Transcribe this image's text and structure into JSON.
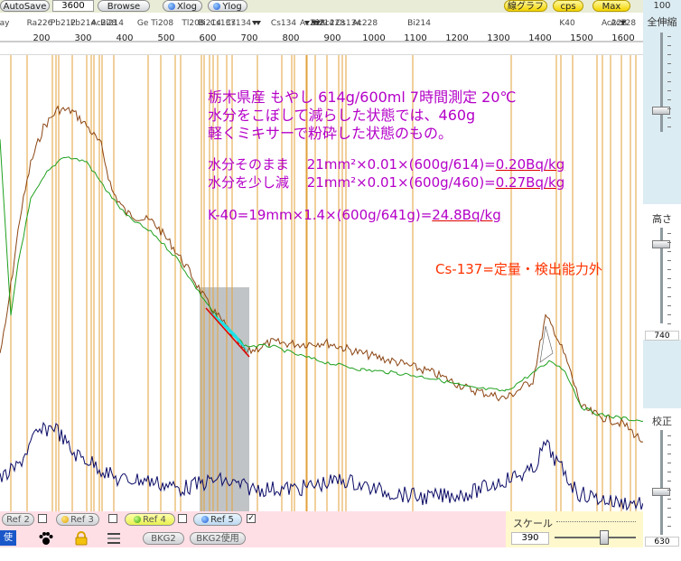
{
  "toolbar": {
    "autosave": "AutoSave",
    "time_value": "3600",
    "browse": "Browse",
    "xlog": "Xlog",
    "ylog": "Ylog",
    "graph_button": "線グラフ",
    "cps_button": "cps",
    "max_button": "Max"
  },
  "right_panel": {
    "top_value": "100",
    "zoom_label": "全伸縮",
    "height_label": "高さ",
    "height_value": "740",
    "calib_label": "校正",
    "calib_value": "630"
  },
  "axis": {
    "ticks": [
      "200",
      "300",
      "400",
      "500",
      "600",
      "700",
      "800",
      "900",
      "1000",
      "1100",
      "1200",
      "1300",
      "1400",
      "1500",
      "1600"
    ],
    "isotopes": [
      {
        "text": "ay"
      },
      {
        "text": "Ra226"
      },
      {
        "text": "Pb212"
      },
      {
        "text": "Pb214"
      },
      {
        "text": "Ac228"
      },
      {
        "text": "Bi214"
      },
      {
        "text": "Ge Ti208"
      },
      {
        "text": "Tl208"
      },
      {
        "text": "Bi214"
      },
      {
        "text": "Cs137"
      },
      {
        "text": "Cs134"
      },
      {
        "text": "Cs134"
      },
      {
        "text": "Ac228"
      },
      {
        "text": "Bi214"
      },
      {
        "text": "Ac228"
      },
      {
        "text": "Cs134"
      },
      {
        "text": "Ac228"
      },
      {
        "text": "Bi214"
      },
      {
        "text": "K40"
      },
      {
        "text": "Ac228"
      },
      {
        "text": "Ac228"
      }
    ]
  },
  "annotation": {
    "line1": "栃木県産 もやし 614g/600ml 7時間測定 20℃",
    "line2": "水分をこぼして減らした状態では、460g",
    "line3": "軽くミキサーで粉砕した状態のもの。",
    "line4a": "水分そのまま　 21mm²×0.01×(600g/614)=",
    "line4b": "0.20Bq/kg",
    "line5a": "水分を少し減　 21mm²×0.01×(600g/460)=",
    "line5b": "0.27Bq/kg",
    "line6a": "K-40=19mm×1.4×(600g/641g)=",
    "line6b": "24.8Bq/kg",
    "line7": "Cs-137=定量・検出能力外"
  },
  "bottom": {
    "ref2": "Ref 2",
    "ref3": "Ref 3",
    "ref4": "Ref 4",
    "ref5": "Ref 5",
    "use_label": "使用",
    "bkg2": "BKG2",
    "bkg2_use": "BKG2使用",
    "scale_label": "スケール",
    "scale_value": "390"
  },
  "colors": {
    "spectrum_brown": "#8b4513",
    "spectrum_green": "#1ea01e",
    "background_line": "#0a0a66",
    "isotope_lines": "#e3a23a",
    "annotation_text": "#b400c8",
    "cs_text": "#ff3300",
    "underline": "#e00000"
  }
}
